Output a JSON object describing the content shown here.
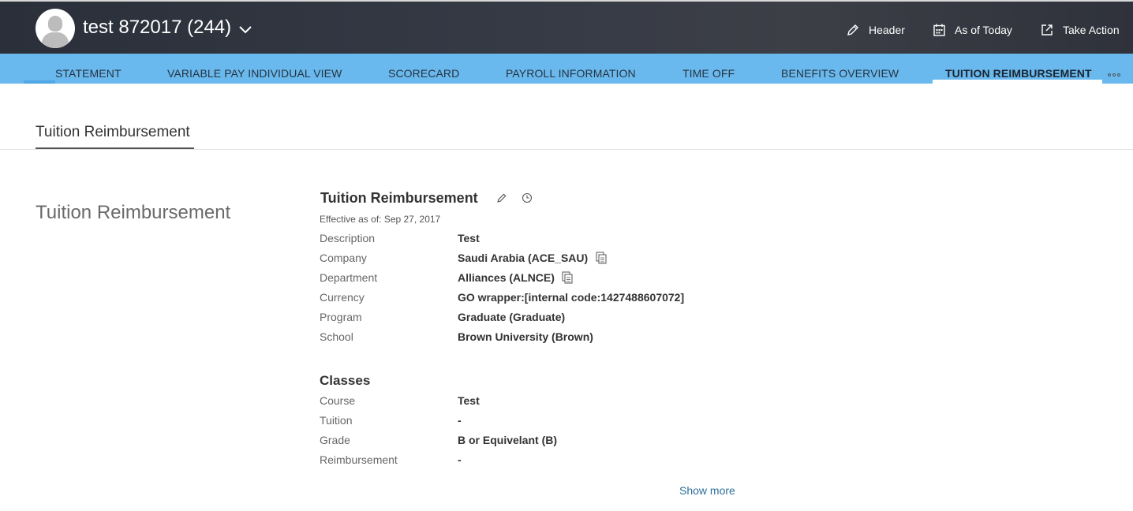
{
  "header": {
    "employee_name": "test 872017 (244)",
    "actions": [
      {
        "label": "Header",
        "icon": "pencil-icon"
      },
      {
        "label": "As of Today",
        "icon": "calendar-icon"
      },
      {
        "label": "Take Action",
        "icon": "external-link-icon"
      }
    ]
  },
  "tabs": [
    {
      "label": "STATEMENT"
    },
    {
      "label": "VARIABLE PAY INDIVIDUAL VIEW"
    },
    {
      "label": "SCORECARD"
    },
    {
      "label": "PAYROLL INFORMATION"
    },
    {
      "label": "TIME OFF"
    },
    {
      "label": "BENEFITS OVERVIEW"
    },
    {
      "label": "TUITION REIMBURSEMENT",
      "active": true
    }
  ],
  "section": {
    "tab_label": "Tuition Reimbursement",
    "side_title": "Tuition Reimbursement"
  },
  "block": {
    "title": "Tuition Reimbursement",
    "effective": "Effective as of: Sep 27, 2017",
    "fields": [
      {
        "label": "Description",
        "value": "Test"
      },
      {
        "label": "Company",
        "value": "Saudi Arabia (ACE_SAU)"
      },
      {
        "label": "Department",
        "value": "Alliances (ALNCE)"
      },
      {
        "label": "Currency",
        "value": "GO wrapper:[internal code:1427488607072]"
      },
      {
        "label": "Program",
        "value": "Graduate (Graduate)"
      },
      {
        "label": "School",
        "value": "Brown University (Brown)"
      }
    ]
  },
  "classes": {
    "title": "Classes",
    "fields": [
      {
        "label": "Course",
        "value": "Test"
      },
      {
        "label": "Tuition",
        "value": "-"
      },
      {
        "label": "Grade",
        "value": "B or Equivelant (B)"
      },
      {
        "label": "Reimbursement",
        "value": "-"
      }
    ]
  },
  "show_more": "Show more",
  "colors": {
    "topbar": "#2f333d",
    "tabbar": "#6ab9ee",
    "link": "#2b6f9b"
  }
}
